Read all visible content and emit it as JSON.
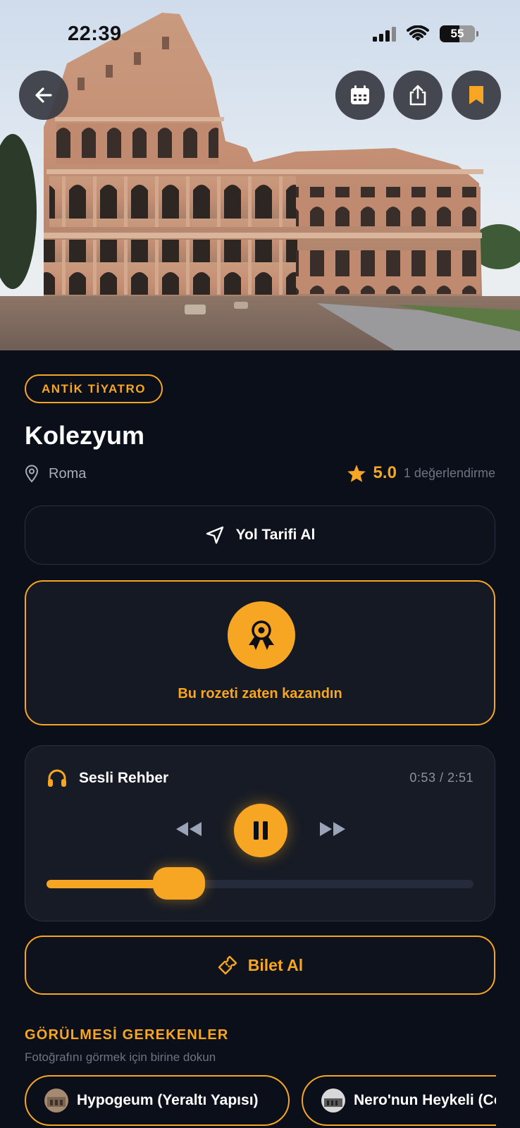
{
  "status_bar": {
    "time": "22:39",
    "battery": "55"
  },
  "header_actions": {
    "back": "back-arrow-icon",
    "calendar": "calendar-icon",
    "share": "share-icon",
    "bookmark": "bookmark-icon"
  },
  "place": {
    "category": "ANTİK TİYATRO",
    "name": "Kolezyum",
    "location": "Roma",
    "rating": "5.0",
    "rating_count": "1 değerlendirme"
  },
  "directions": {
    "label": "Yol Tarifi Al"
  },
  "badge": {
    "text": "Bu rozeti zaten kazandın"
  },
  "audio_guide": {
    "title": "Sesli Rehber",
    "time": "0:53 / 2:51",
    "progress": 0.31,
    "state": "playing"
  },
  "ticket": {
    "label": "Bilet Al"
  },
  "must_see": {
    "title": "GÖRÜLMESİ GEREKENLER",
    "subtitle": "Fotoğrafını görmek için birine dokun",
    "items": [
      {
        "label": "Hypogeum (Yeraltı Yapısı)"
      },
      {
        "label": "Nero'nun Heykeli (Colossus Neronis)"
      }
    ]
  },
  "colors": {
    "accent": "#f6a623",
    "background": "#0b0f19",
    "card": "#161b25"
  }
}
